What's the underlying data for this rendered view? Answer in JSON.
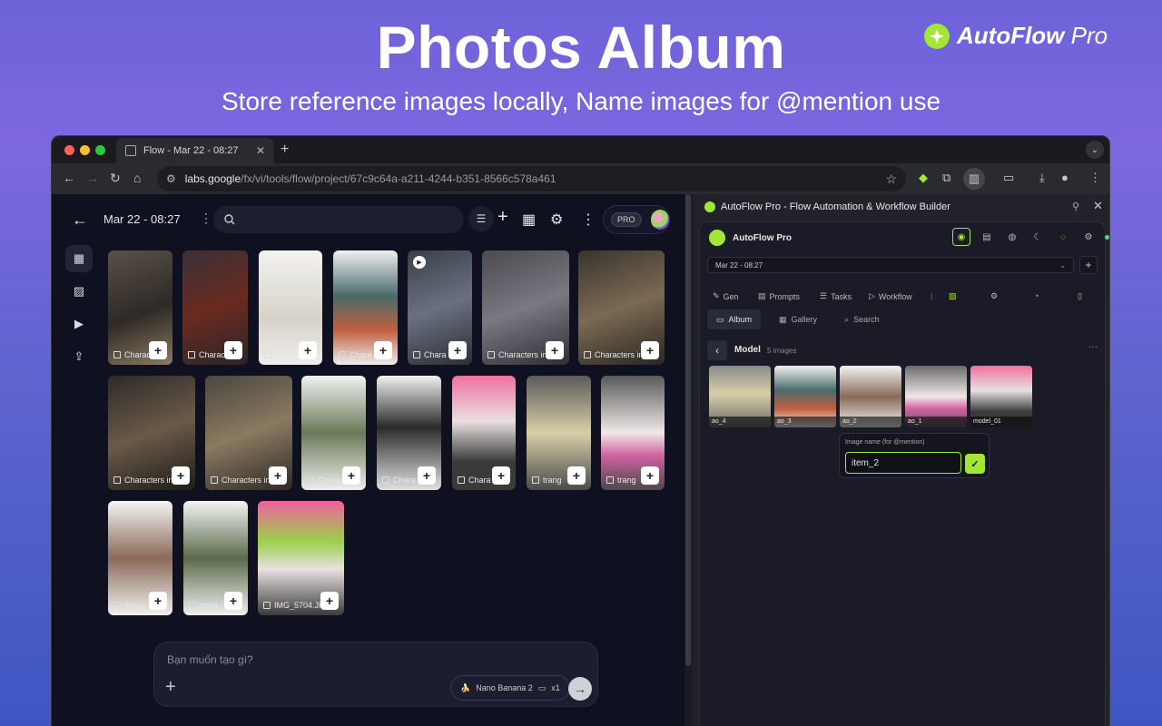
{
  "hero": {
    "title": "Photos Album",
    "subtitle": "Store reference images locally, Name images for @mention use",
    "brand_bold": "AutoFlow",
    "brand_light": "Pro"
  },
  "browser": {
    "tab_title": "Flow - Mar 22 - 08:27",
    "url_host": "labs.google",
    "url_path": "/fx/vi/tools/flow/project/67c9c64a-a211-4244-b351-8566c578a461"
  },
  "app": {
    "project_title": "Mar 22 - 08:27",
    "pro_label": "PRO",
    "captions": {
      "characters": "Characters in",
      "chara": "Chara",
      "trang": "trang",
      "img": "IMG_5704.JPG"
    },
    "prompt_placeholder": "Bạn muốn tạo gì?",
    "model_label": "Nano Banana 2",
    "model_count": "x1"
  },
  "panel": {
    "header_title": "AutoFlow Pro - Flow Automation & Workflow Builder",
    "brand_name": "AutoFlow Pro",
    "project_select": "Mar 22 - 08:27",
    "tabs": {
      "gen": "Gen",
      "prompts": "Prompts",
      "tasks": "Tasks",
      "workflow": "Workflow"
    },
    "subtabs": {
      "album": "Album",
      "gallery": "Gallery",
      "search": "Search"
    },
    "album_name": "Model",
    "album_count": "5 images",
    "thumbs": [
      "ao_4",
      "ao_3",
      "ao_2",
      "ao_1",
      "model_01"
    ],
    "rename_label": "Image name (for @mention)",
    "rename_value": "item_2"
  },
  "colors": {
    "accent": "#a3e635",
    "app_bg": "#0f1020",
    "panel_bg": "#1a1b26"
  }
}
